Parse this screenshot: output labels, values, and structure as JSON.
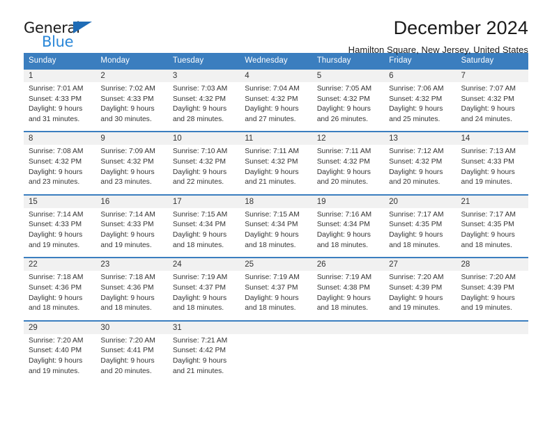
{
  "brand": {
    "name_part1": "General",
    "name_part2": "Blue",
    "triangle_color": "#1f6cb6",
    "blue_color": "#2a87d8"
  },
  "header": {
    "title": "December 2024",
    "subtitle": "Hamilton Square, New Jersey, United States"
  },
  "theme": {
    "header_row_bg": "#3b7ebf",
    "day_number_bg": "#f1f1f1",
    "cell_bg": "#ffffff",
    "text_color": "#333333"
  },
  "weekday_headers": [
    "Sunday",
    "Monday",
    "Tuesday",
    "Wednesday",
    "Thursday",
    "Friday",
    "Saturday"
  ],
  "weeks": [
    {
      "days": [
        {
          "number": "1",
          "sunrise": "Sunrise: 7:01 AM",
          "sunset": "Sunset: 4:33 PM",
          "daylight_line1": "Daylight: 9 hours",
          "daylight_line2": "and 31 minutes."
        },
        {
          "number": "2",
          "sunrise": "Sunrise: 7:02 AM",
          "sunset": "Sunset: 4:33 PM",
          "daylight_line1": "Daylight: 9 hours",
          "daylight_line2": "and 30 minutes."
        },
        {
          "number": "3",
          "sunrise": "Sunrise: 7:03 AM",
          "sunset": "Sunset: 4:32 PM",
          "daylight_line1": "Daylight: 9 hours",
          "daylight_line2": "and 28 minutes."
        },
        {
          "number": "4",
          "sunrise": "Sunrise: 7:04 AM",
          "sunset": "Sunset: 4:32 PM",
          "daylight_line1": "Daylight: 9 hours",
          "daylight_line2": "and 27 minutes."
        },
        {
          "number": "5",
          "sunrise": "Sunrise: 7:05 AM",
          "sunset": "Sunset: 4:32 PM",
          "daylight_line1": "Daylight: 9 hours",
          "daylight_line2": "and 26 minutes."
        },
        {
          "number": "6",
          "sunrise": "Sunrise: 7:06 AM",
          "sunset": "Sunset: 4:32 PM",
          "daylight_line1": "Daylight: 9 hours",
          "daylight_line2": "and 25 minutes."
        },
        {
          "number": "7",
          "sunrise": "Sunrise: 7:07 AM",
          "sunset": "Sunset: 4:32 PM",
          "daylight_line1": "Daylight: 9 hours",
          "daylight_line2": "and 24 minutes."
        }
      ]
    },
    {
      "days": [
        {
          "number": "8",
          "sunrise": "Sunrise: 7:08 AM",
          "sunset": "Sunset: 4:32 PM",
          "daylight_line1": "Daylight: 9 hours",
          "daylight_line2": "and 23 minutes."
        },
        {
          "number": "9",
          "sunrise": "Sunrise: 7:09 AM",
          "sunset": "Sunset: 4:32 PM",
          "daylight_line1": "Daylight: 9 hours",
          "daylight_line2": "and 23 minutes."
        },
        {
          "number": "10",
          "sunrise": "Sunrise: 7:10 AM",
          "sunset": "Sunset: 4:32 PM",
          "daylight_line1": "Daylight: 9 hours",
          "daylight_line2": "and 22 minutes."
        },
        {
          "number": "11",
          "sunrise": "Sunrise: 7:11 AM",
          "sunset": "Sunset: 4:32 PM",
          "daylight_line1": "Daylight: 9 hours",
          "daylight_line2": "and 21 minutes."
        },
        {
          "number": "12",
          "sunrise": "Sunrise: 7:11 AM",
          "sunset": "Sunset: 4:32 PM",
          "daylight_line1": "Daylight: 9 hours",
          "daylight_line2": "and 20 minutes."
        },
        {
          "number": "13",
          "sunrise": "Sunrise: 7:12 AM",
          "sunset": "Sunset: 4:32 PM",
          "daylight_line1": "Daylight: 9 hours",
          "daylight_line2": "and 20 minutes."
        },
        {
          "number": "14",
          "sunrise": "Sunrise: 7:13 AM",
          "sunset": "Sunset: 4:33 PM",
          "daylight_line1": "Daylight: 9 hours",
          "daylight_line2": "and 19 minutes."
        }
      ]
    },
    {
      "days": [
        {
          "number": "15",
          "sunrise": "Sunrise: 7:14 AM",
          "sunset": "Sunset: 4:33 PM",
          "daylight_line1": "Daylight: 9 hours",
          "daylight_line2": "and 19 minutes."
        },
        {
          "number": "16",
          "sunrise": "Sunrise: 7:14 AM",
          "sunset": "Sunset: 4:33 PM",
          "daylight_line1": "Daylight: 9 hours",
          "daylight_line2": "and 19 minutes."
        },
        {
          "number": "17",
          "sunrise": "Sunrise: 7:15 AM",
          "sunset": "Sunset: 4:34 PM",
          "daylight_line1": "Daylight: 9 hours",
          "daylight_line2": "and 18 minutes."
        },
        {
          "number": "18",
          "sunrise": "Sunrise: 7:15 AM",
          "sunset": "Sunset: 4:34 PM",
          "daylight_line1": "Daylight: 9 hours",
          "daylight_line2": "and 18 minutes."
        },
        {
          "number": "19",
          "sunrise": "Sunrise: 7:16 AM",
          "sunset": "Sunset: 4:34 PM",
          "daylight_line1": "Daylight: 9 hours",
          "daylight_line2": "and 18 minutes."
        },
        {
          "number": "20",
          "sunrise": "Sunrise: 7:17 AM",
          "sunset": "Sunset: 4:35 PM",
          "daylight_line1": "Daylight: 9 hours",
          "daylight_line2": "and 18 minutes."
        },
        {
          "number": "21",
          "sunrise": "Sunrise: 7:17 AM",
          "sunset": "Sunset: 4:35 PM",
          "daylight_line1": "Daylight: 9 hours",
          "daylight_line2": "and 18 minutes."
        }
      ]
    },
    {
      "days": [
        {
          "number": "22",
          "sunrise": "Sunrise: 7:18 AM",
          "sunset": "Sunset: 4:36 PM",
          "daylight_line1": "Daylight: 9 hours",
          "daylight_line2": "and 18 minutes."
        },
        {
          "number": "23",
          "sunrise": "Sunrise: 7:18 AM",
          "sunset": "Sunset: 4:36 PM",
          "daylight_line1": "Daylight: 9 hours",
          "daylight_line2": "and 18 minutes."
        },
        {
          "number": "24",
          "sunrise": "Sunrise: 7:19 AM",
          "sunset": "Sunset: 4:37 PM",
          "daylight_line1": "Daylight: 9 hours",
          "daylight_line2": "and 18 minutes."
        },
        {
          "number": "25",
          "sunrise": "Sunrise: 7:19 AM",
          "sunset": "Sunset: 4:37 PM",
          "daylight_line1": "Daylight: 9 hours",
          "daylight_line2": "and 18 minutes."
        },
        {
          "number": "26",
          "sunrise": "Sunrise: 7:19 AM",
          "sunset": "Sunset: 4:38 PM",
          "daylight_line1": "Daylight: 9 hours",
          "daylight_line2": "and 18 minutes."
        },
        {
          "number": "27",
          "sunrise": "Sunrise: 7:20 AM",
          "sunset": "Sunset: 4:39 PM",
          "daylight_line1": "Daylight: 9 hours",
          "daylight_line2": "and 19 minutes."
        },
        {
          "number": "28",
          "sunrise": "Sunrise: 7:20 AM",
          "sunset": "Sunset: 4:39 PM",
          "daylight_line1": "Daylight: 9 hours",
          "daylight_line2": "and 19 minutes."
        }
      ]
    },
    {
      "days": [
        {
          "number": "29",
          "sunrise": "Sunrise: 7:20 AM",
          "sunset": "Sunset: 4:40 PM",
          "daylight_line1": "Daylight: 9 hours",
          "daylight_line2": "and 19 minutes."
        },
        {
          "number": "30",
          "sunrise": "Sunrise: 7:20 AM",
          "sunset": "Sunset: 4:41 PM",
          "daylight_line1": "Daylight: 9 hours",
          "daylight_line2": "and 20 minutes."
        },
        {
          "number": "31",
          "sunrise": "Sunrise: 7:21 AM",
          "sunset": "Sunset: 4:42 PM",
          "daylight_line1": "Daylight: 9 hours",
          "daylight_line2": "and 21 minutes."
        },
        {
          "number": "",
          "sunrise": "",
          "sunset": "",
          "daylight_line1": "",
          "daylight_line2": ""
        },
        {
          "number": "",
          "sunrise": "",
          "sunset": "",
          "daylight_line1": "",
          "daylight_line2": ""
        },
        {
          "number": "",
          "sunrise": "",
          "sunset": "",
          "daylight_line1": "",
          "daylight_line2": ""
        },
        {
          "number": "",
          "sunrise": "",
          "sunset": "",
          "daylight_line1": "",
          "daylight_line2": ""
        }
      ]
    }
  ]
}
